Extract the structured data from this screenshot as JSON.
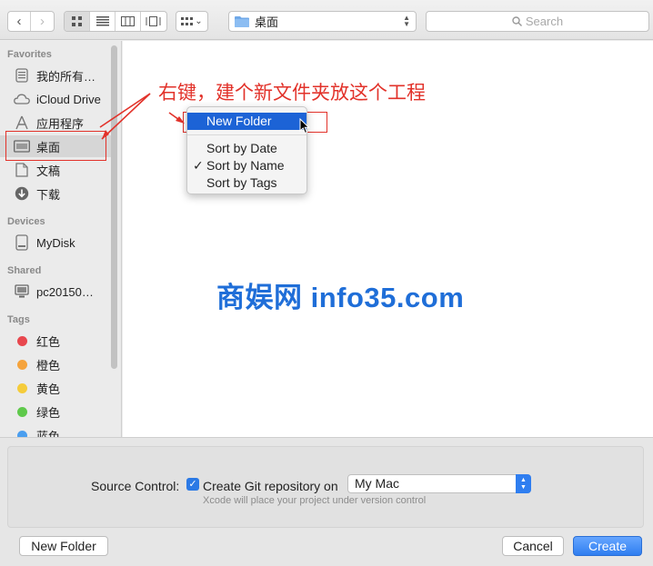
{
  "toolbar": {
    "back": "‹",
    "forward": "›",
    "path_folder": "桌面",
    "search_placeholder": "Search"
  },
  "sidebar": {
    "sections": {
      "favorites": "Favorites",
      "devices": "Devices",
      "shared": "Shared",
      "tags": "Tags"
    },
    "favorites": [
      {
        "label": "我的所有…",
        "icon": "all-files-icon"
      },
      {
        "label": "iCloud Drive",
        "icon": "cloud-icon"
      },
      {
        "label": "应用程序",
        "icon": "applications-icon"
      },
      {
        "label": "桌面",
        "icon": "desktop-icon",
        "selected": true
      },
      {
        "label": "文稿",
        "icon": "documents-icon"
      },
      {
        "label": "下载",
        "icon": "downloads-icon"
      }
    ],
    "devices": [
      {
        "label": "MyDisk",
        "icon": "disk-icon"
      }
    ],
    "shared": [
      {
        "label": "pc20150…",
        "icon": "computer-icon"
      }
    ],
    "tags": [
      {
        "label": "红色",
        "color": "#e8474e"
      },
      {
        "label": "橙色",
        "color": "#f5a33c"
      },
      {
        "label": "黄色",
        "color": "#f5cc3b"
      },
      {
        "label": "绿色",
        "color": "#5fc94b"
      },
      {
        "label": "蓝色",
        "color": "#4a9eef"
      }
    ]
  },
  "annotation": {
    "text": "右键，建个新文件夹放这个工程",
    "color": "#e2322a"
  },
  "context_menu": {
    "new_folder": "New Folder",
    "sort_date": "Sort by Date",
    "sort_name": "Sort by Name",
    "sort_tags": "Sort by Tags",
    "check": "✓"
  },
  "watermark": "商娱网 info35.com",
  "source_control": {
    "label": "Source Control:",
    "checkbox_label": "Create Git repository on",
    "checked": true,
    "location": "My Mac",
    "hint": "Xcode will place your project under version control"
  },
  "buttons": {
    "new_folder": "New Folder",
    "cancel": "Cancel",
    "create": "Create"
  },
  "colors": {
    "accent": "#2f7ef0",
    "menu_highlight": "#1c63d6"
  }
}
